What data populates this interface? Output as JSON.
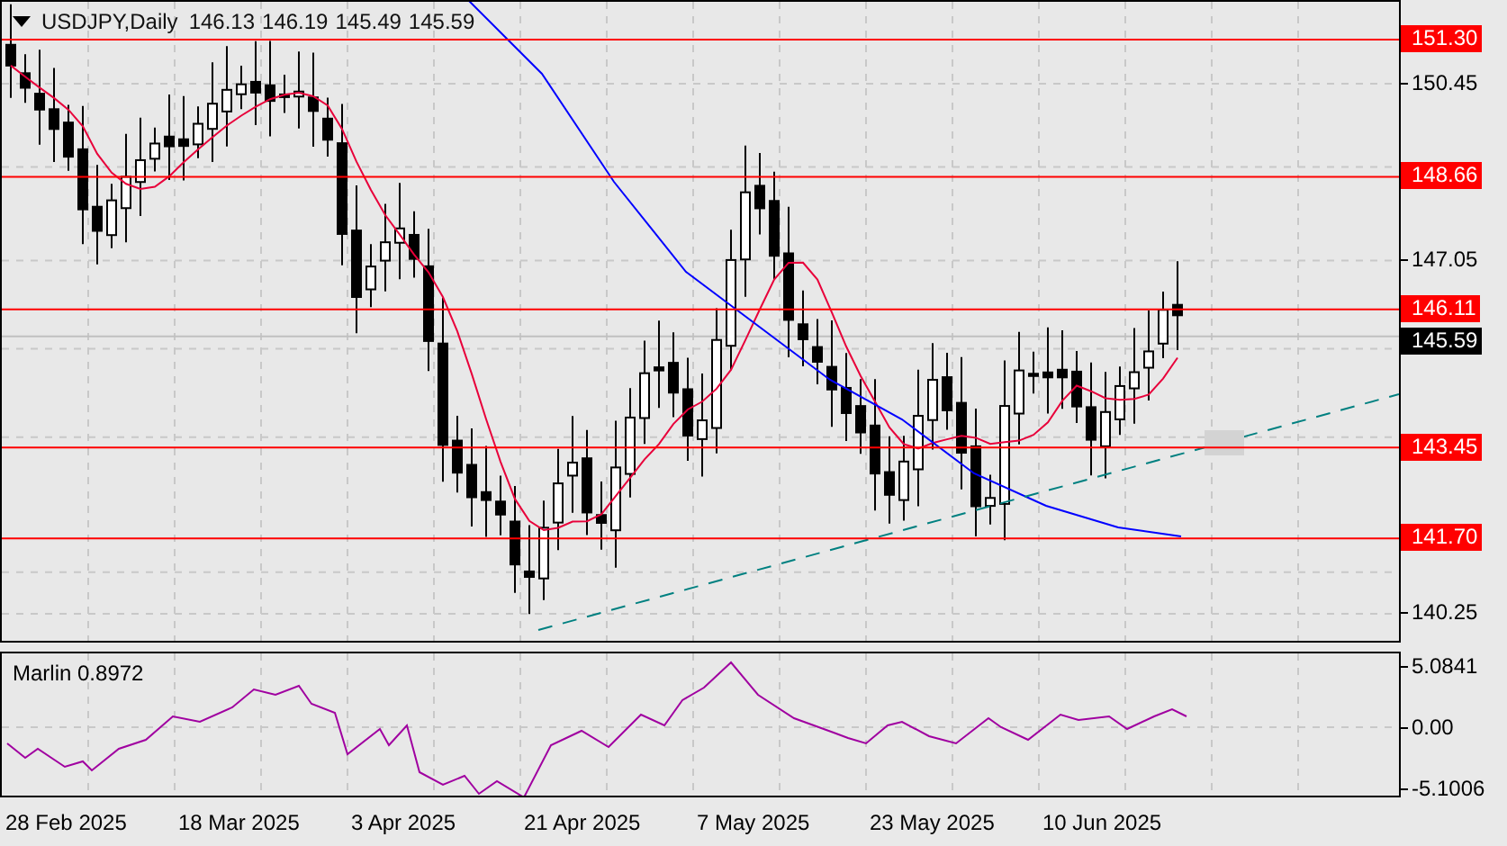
{
  "header": {
    "symbol": "USDJPY,Daily",
    "ohlc": [
      "146.13",
      "146.19",
      "145.49",
      "145.59"
    ]
  },
  "price_axis": {
    "ticks": [
      "150.45",
      "147.05",
      "140.25"
    ]
  },
  "levels": [
    {
      "price": "151.30"
    },
    {
      "price": "148.66"
    },
    {
      "price": "146.11"
    },
    {
      "price": "143.45"
    },
    {
      "price": "141.70"
    }
  ],
  "current_price": "145.59",
  "indicator": {
    "title": "Marlin 0.8972",
    "ticks": [
      "5.0841",
      "0.00",
      "-5.1006"
    ]
  },
  "date_axis": [
    "28 Feb 2025",
    "18 Mar 2025",
    "3 Apr 2025",
    "21 Apr 2025",
    "7 May 2025",
    "23 May 2025",
    "10 Jun 2025"
  ]
}
